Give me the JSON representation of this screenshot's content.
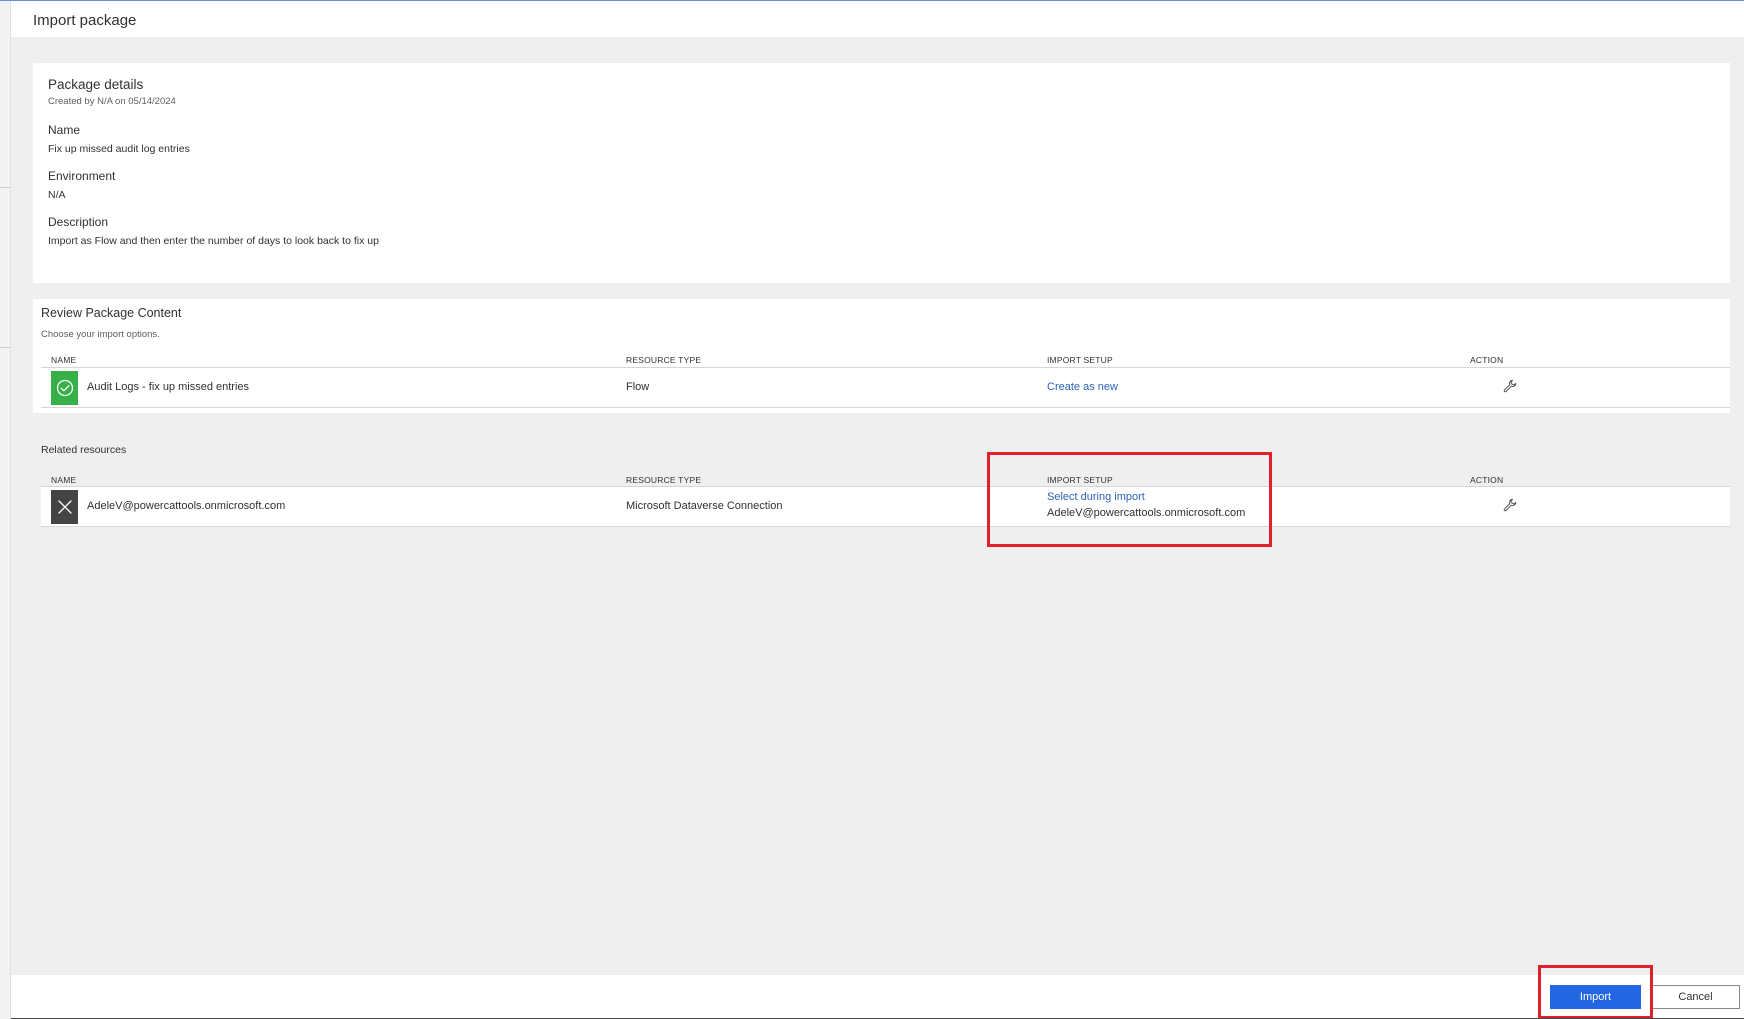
{
  "header": {
    "title": "Import package"
  },
  "package_details": {
    "title": "Package details",
    "subtitle": "Created by N/A on 05/14/2024",
    "fields": [
      {
        "label": "Name",
        "value": "Fix up missed audit log entries"
      },
      {
        "label": "Environment",
        "value": "N/A"
      },
      {
        "label": "Description",
        "value": "Import as Flow and then enter the number of days to look back to fix up"
      }
    ]
  },
  "review": {
    "title": "Review Package Content",
    "subtitle": "Choose your import options.",
    "columns": [
      "NAME",
      "RESOURCE TYPE",
      "IMPORT SETUP",
      "ACTION"
    ],
    "rows": [
      {
        "name": "Audit Logs - fix up missed entries",
        "resource_type": "Flow",
        "import_setup": "Create as new",
        "status_icon": "check-circle-icon",
        "action_icon": "wrench-icon"
      }
    ]
  },
  "related": {
    "title": "Related resources",
    "columns": [
      "NAME",
      "RESOURCE TYPE",
      "IMPORT SETUP",
      "ACTION"
    ],
    "rows": [
      {
        "name": "AdeleV@powercattools.onmicrosoft.com",
        "resource_type": "Microsoft Dataverse Connection",
        "import_setup_link": "Select during import",
        "import_setup_value": "AdeleV@powercattools.onmicrosoft.com",
        "status_icon": "close-icon",
        "action_icon": "wrench-icon"
      }
    ]
  },
  "footer": {
    "import_label": "Import",
    "cancel_label": "Cancel"
  },
  "colors": {
    "accent": "#2266e3",
    "link": "#2b63b8",
    "success": "#37b04a",
    "highlight": "#e0202a",
    "background": "#efefef"
  }
}
